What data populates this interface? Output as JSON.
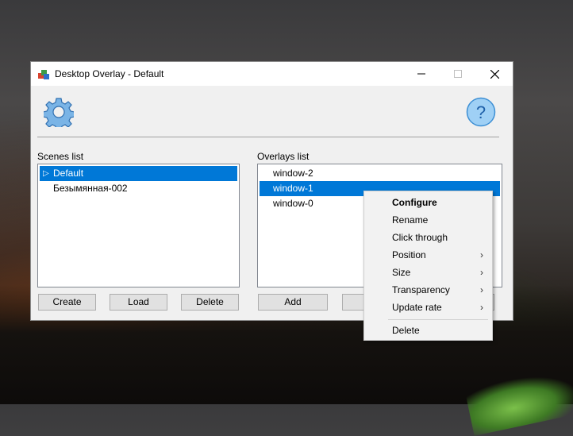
{
  "window": {
    "title": "Desktop Overlay - Default",
    "controls": {
      "minimize": "—",
      "maximize": "☐",
      "close": "✕"
    }
  },
  "toolbar": {
    "settings_icon": "gear-icon",
    "help_icon": "help-icon",
    "help_glyph": "?"
  },
  "scenes": {
    "label": "Scenes list",
    "items": [
      {
        "label": "Default",
        "selected": true,
        "marker": "▷"
      },
      {
        "label": "Безымянная-002",
        "selected": false
      }
    ],
    "buttons": {
      "create": "Create",
      "load": "Load",
      "delete": "Delete"
    }
  },
  "overlays": {
    "label": "Overlays list",
    "items": [
      {
        "label": "window-2",
        "selected": false
      },
      {
        "label": "window-1",
        "selected": true
      },
      {
        "label": "window-0",
        "selected": false
      }
    ],
    "buttons": {
      "add": "Add"
    }
  },
  "context_menu": {
    "items": [
      {
        "label": "Configure",
        "bold": true
      },
      {
        "label": "Rename"
      },
      {
        "label": "Click through"
      },
      {
        "label": "Position",
        "submenu": true
      },
      {
        "label": "Size",
        "submenu": true
      },
      {
        "label": "Transparency",
        "submenu": true
      },
      {
        "label": "Update rate",
        "submenu": true
      },
      {
        "label": "Delete"
      }
    ],
    "submenu_arrow": "›"
  },
  "colors": {
    "selection": "#0078d7",
    "help_circle": "#9fd0f5",
    "gear": "#4a8fd0"
  }
}
